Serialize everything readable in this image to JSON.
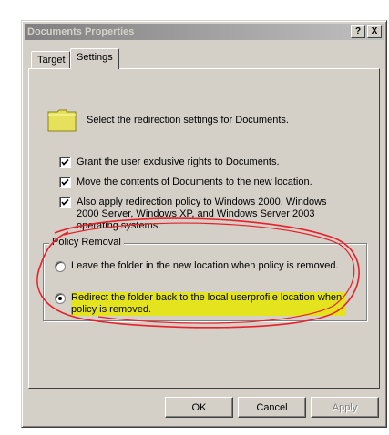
{
  "window": {
    "title": "Documents Properties",
    "help_button": "?",
    "close_button": "X"
  },
  "tabs": [
    {
      "label": "Target",
      "active": false
    },
    {
      "label": "Settings",
      "active": true
    }
  ],
  "settings": {
    "description": "Select the redirection settings for Documents.",
    "checkboxes": [
      {
        "label": "Grant the user exclusive rights to Documents.",
        "checked": true
      },
      {
        "label": "Move the contents of Documents to the new location.",
        "checked": true
      },
      {
        "label": "Also apply redirection policy to Windows 2000, Windows 2000 Server, Windows XP, and Windows Server 2003 operating systems.",
        "checked": true
      }
    ],
    "policy_removal": {
      "title": "Policy Removal",
      "options": [
        {
          "label": "Leave the folder in the new location when policy is removed.",
          "selected": false
        },
        {
          "label": "Redirect the folder back to the local userprofile location when policy is removed.",
          "selected": true
        }
      ]
    }
  },
  "buttons": {
    "ok": "OK",
    "cancel": "Cancel",
    "apply": "Apply"
  },
  "colors": {
    "annotation_circle": "#e8202a",
    "highlight": "#e4e41e"
  }
}
